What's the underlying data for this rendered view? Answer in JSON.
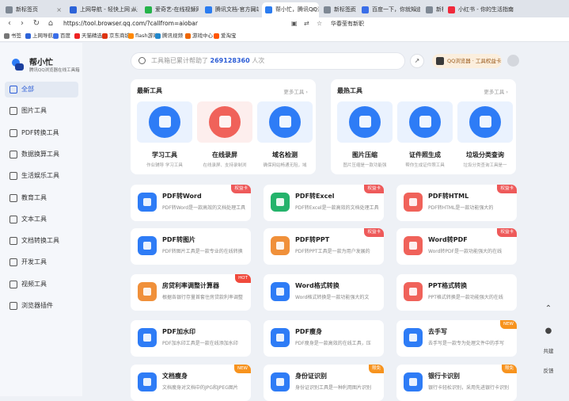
{
  "tabs": [
    {
      "label": "新标签页",
      "color": "#7e8894"
    },
    {
      "label": "上网导航 - 轻快上网 从这",
      "color": "#2d63d8"
    },
    {
      "label": "爱奇艺-在线视频网站-海量",
      "color": "#25b34a"
    },
    {
      "label": "腾讯文档-官方网站-支持多",
      "color": "#2b7cf0"
    },
    {
      "label": "帮小忙，腾讯QQ浏览器",
      "color": "#2b7cf0",
      "active": true
    },
    {
      "label": "新标签页",
      "color": "#7e8894"
    },
    {
      "label": "百度一下，你就知道",
      "color": "#3a6ee8"
    },
    {
      "label": "新标签页",
      "color": "#7e8894"
    },
    {
      "label": "小红书 - 你的生活指南",
      "color": "#f0293b"
    }
  ],
  "address": {
    "url": "https://tool.browser.qq.com/?callfrom=aiobar",
    "promo": "华春莹有新职"
  },
  "bookmarks": [
    {
      "label": "书签",
      "color": "#777"
    },
    {
      "label": "上网导航",
      "color": "#2d63d8"
    },
    {
      "label": "百度",
      "color": "#3a6ee8"
    },
    {
      "label": "天猫精选",
      "color": "#e22"
    },
    {
      "label": "京东商城",
      "color": "#d31"
    },
    {
      "label": "flash游戏",
      "color": "#f80"
    },
    {
      "label": "腾讯视频",
      "color": "#28c"
    },
    {
      "label": "游戏中心",
      "color": "#e60"
    },
    {
      "label": "爱淘宝",
      "color": "#f50"
    }
  ],
  "sidebar": {
    "title": "帮小忙",
    "subtitle": "腾讯QQ浏览器在线工具箱",
    "items": [
      {
        "label": "全部"
      },
      {
        "label": "图片工具"
      },
      {
        "label": "PDF转换工具"
      },
      {
        "label": "数据换算工具"
      },
      {
        "label": "生活娱乐工具"
      },
      {
        "label": "教育工具"
      },
      {
        "label": "文本工具"
      },
      {
        "label": "文档转换工具"
      },
      {
        "label": "开发工具"
      },
      {
        "label": "视频工具"
      },
      {
        "label": "浏览器插件"
      }
    ]
  },
  "search": {
    "prefix": "工具箱已累计帮助了",
    "count": "269128360",
    "suffix": "人次"
  },
  "header": {
    "qq_label": "QQ浏览器 · 工具权益卡"
  },
  "panels": [
    {
      "title": "最新工具",
      "more": "更多工具",
      "items": [
        {
          "name": "学习工具",
          "desc": "作业辅导 学习工具",
          "color": "#2e7cf6",
          "bg": "#eaf2fe"
        },
        {
          "name": "在线录屏",
          "desc": "在线录屏、支持录制浏",
          "color": "#f0625a",
          "bg": "#fdeeed"
        },
        {
          "name": "域名检测",
          "desc": "确保网站畅通无阻，域",
          "color": "#2e7cf6",
          "bg": "#eaf2fe"
        }
      ]
    },
    {
      "title": "最热工具",
      "more": "更多工具",
      "items": [
        {
          "name": "图片压缩",
          "desc": "图片压缩是一款功能强",
          "color": "#2e7cf6",
          "bg": "#eaf2fe"
        },
        {
          "name": "证件照生成",
          "desc": "帮你生成证件照工具",
          "color": "#2e7cf6",
          "bg": "#eaf2fe"
        },
        {
          "name": "垃圾分类查询",
          "desc": "垃圾分类查询工具是一",
          "color": "#2e7cf6",
          "bg": "#eaf2fe"
        }
      ]
    }
  ],
  "cards": [
    {
      "name": "PDF转Word",
      "desc": "PDF转Word是一款高效的文档处理工具",
      "color": "#2e7cf6",
      "badge": "权益卡"
    },
    {
      "name": "PDF转Excel",
      "desc": "PDF转Excel是一款高效的文档处理工具",
      "color": "#24b36b",
      "badge": "权益卡"
    },
    {
      "name": "PDF转HTML",
      "desc": "PDF转HTML是一款功能强大的",
      "color": "#f0625a",
      "badge": "权益卡"
    },
    {
      "name": "PDF转图片",
      "desc": "PDF转图片工具是一款专业的在线转换",
      "color": "#2e7cf6",
      "badge": ""
    },
    {
      "name": "PDF转PPT",
      "desc": "PDF转PPT工具是一款为用户发展的",
      "color": "#f0903a",
      "badge": "权益卡"
    },
    {
      "name": "Word转PDF",
      "desc": "Word转PDF是一款功能强大的在线",
      "color": "#f0625a",
      "badge": "权益卡"
    },
    {
      "name": "房贷利率调整计算器",
      "desc": "根据各银行存量首套住房贷款利率调整",
      "color": "#f0903a",
      "badge": "HOT"
    },
    {
      "name": "Word格式转换",
      "desc": "Word格式转换是一款功能强大的文",
      "color": "#2e7cf6",
      "badge": ""
    },
    {
      "name": "PPT格式转换",
      "desc": "PPT格式转换是一款功能强大的在线",
      "color": "#f0625a",
      "badge": ""
    },
    {
      "name": "PDF加水印",
      "desc": "PDF加水印工具是一款在线添加水印",
      "color": "#2e7cf6",
      "badge": ""
    },
    {
      "name": "PDF瘦身",
      "desc": "PDF瘦身是一款高效的在线工具，压",
      "color": "#2e7cf6",
      "badge": ""
    },
    {
      "name": "去手写",
      "desc": "去手写是一款专为处理文件中的手写",
      "color": "#2e7cf6",
      "badge": "NEW"
    },
    {
      "name": "文档瘦身",
      "desc": "文档瘦身对文档中的JPG和JPEG图片",
      "color": "#2e7cf6",
      "badge": "NEW"
    },
    {
      "name": "身份证识别",
      "desc": "身份证识别工具是一种利用图片识别",
      "color": "#2e7cf6",
      "badge": "限免"
    },
    {
      "name": "银行卡识别",
      "desc": "银行卡轻松识别，采用先进银行卡识别",
      "color": "#2e7cf6",
      "badge": "限免"
    }
  ],
  "floating": {
    "top": "返回顶部",
    "qq": "QQ",
    "share": "共建",
    "feedback": "反馈"
  }
}
